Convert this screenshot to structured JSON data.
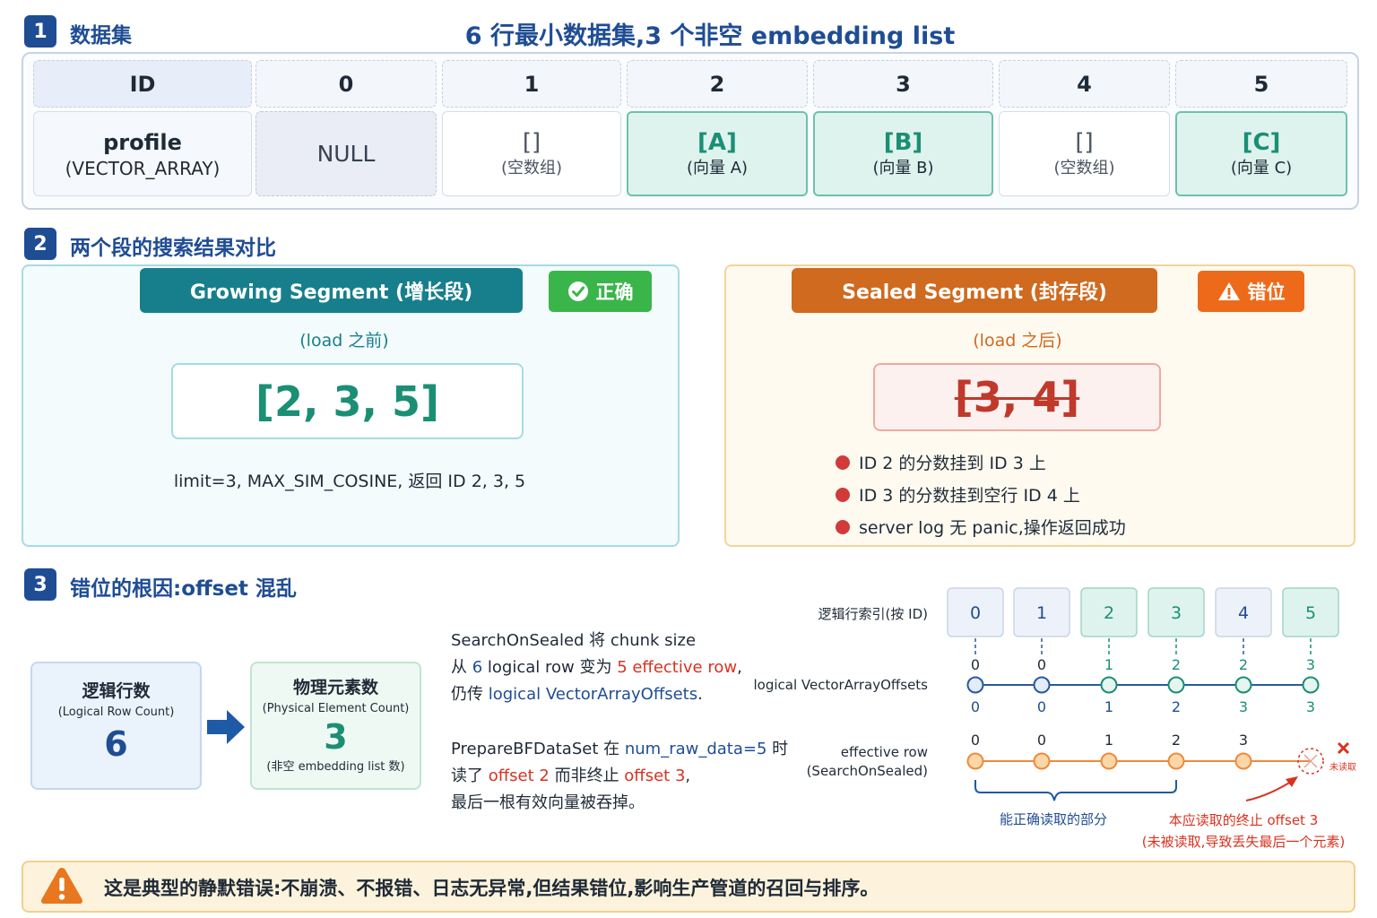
{
  "section1": {
    "num": "1",
    "title": "数据集",
    "main_title": "6 行最小数据集,3 个非空 embedding list",
    "header_label": "ID",
    "ids": [
      "0",
      "1",
      "2",
      "3",
      "4",
      "5"
    ],
    "row_label_main": "profile",
    "row_label_sub": "(VECTOR_ARRAY)",
    "values": [
      {
        "main": "NULL",
        "sub": ""
      },
      {
        "main": "[]",
        "sub": "(空数组)"
      },
      {
        "main": "[A]",
        "sub": "(向量 A)"
      },
      {
        "main": "[B]",
        "sub": "(向量 B)"
      },
      {
        "main": "[]",
        "sub": "(空数组)"
      },
      {
        "main": "[C]",
        "sub": "(向量 C)"
      }
    ]
  },
  "section2": {
    "num": "2",
    "title": "两个段的搜索结果对比",
    "growing": {
      "label": "Growing Segment (增长段)",
      "badge": "正确",
      "note": "(load 之前)",
      "result": "[2, 3, 5]",
      "caption": "limit=3, MAX_SIM_COSINE, 返回 ID 2, 3, 5"
    },
    "sealed": {
      "label": "Sealed Segment (封存段)",
      "badge": "错位",
      "note": "(load 之后)",
      "result": "[3, 4]",
      "bullets": [
        "ID 2 的分数挂到 ID 3 上",
        "ID 3 的分数挂到空行 ID 4 上",
        "server log 无 panic,操作返回成功"
      ]
    }
  },
  "section3": {
    "num": "3",
    "title": "错位的根因:offset 混乱",
    "logical_box": {
      "title": "逻辑行数",
      "sub": "(Logical Row Count)",
      "value": "6"
    },
    "physical_box": {
      "title": "物理元素数",
      "sub": "(Physical Element Count)",
      "value": "3",
      "note": "(非空 embedding list 数)"
    },
    "para1": {
      "line1": "SearchOnSealed 将 chunk size",
      "line2_a": "从 ",
      "line2_b": "6",
      "line2_c": " logical row 变为 ",
      "line2_d": "5 effective row",
      "line2_e": ",",
      "line3_a": "仍传 ",
      "line3_b": "logical VectorArrayOffsets",
      "line3_c": "."
    },
    "para2": {
      "line1_a": "PrepareBFDataSet 在 ",
      "line1_b": "num_raw_data=5",
      "line1_c": " 时",
      "line2_a": "读了 ",
      "line2_b": "offset 2",
      "line2_c": " 而非终止 ",
      "line2_d": "offset 3",
      "line2_e": ",",
      "line3": "最后一根有效向量被吞掉。"
    },
    "diagram": {
      "logical_index_label": "逻辑行索引(按 ID)",
      "offsets_label": "logical VectorArrayOffsets",
      "effective_label_1": "effective row",
      "effective_label_2": "(SearchOnSealed)",
      "index_boxes": [
        "0",
        "1",
        "2",
        "3",
        "4",
        "5"
      ],
      "offsets_top": [
        "0",
        "0",
        "1",
        "2",
        "2",
        "3"
      ],
      "offsets_bottom": [
        "0",
        "0",
        "1",
        "2",
        "3",
        "3"
      ],
      "effective_top": [
        "0",
        "0",
        "1",
        "2",
        "3"
      ],
      "not_read_mark": "未读取",
      "brace_label": "能正确读取的部分",
      "missing_label_1": "本应读取的终止 offset 3",
      "missing_label_2": "(未被读取,导致丢失最后一个元素)"
    }
  },
  "warning": {
    "text": "这是典型的静默错误:不崩溃、不报错、日志无异常,但结果错位,影响生产管道的召回与排序。"
  },
  "colors": {
    "navy": "#1f4d94",
    "teal": "#1a8f74",
    "orange": "#cf6a1f",
    "red": "#d9321f",
    "green_badge": "#3ab54a"
  }
}
